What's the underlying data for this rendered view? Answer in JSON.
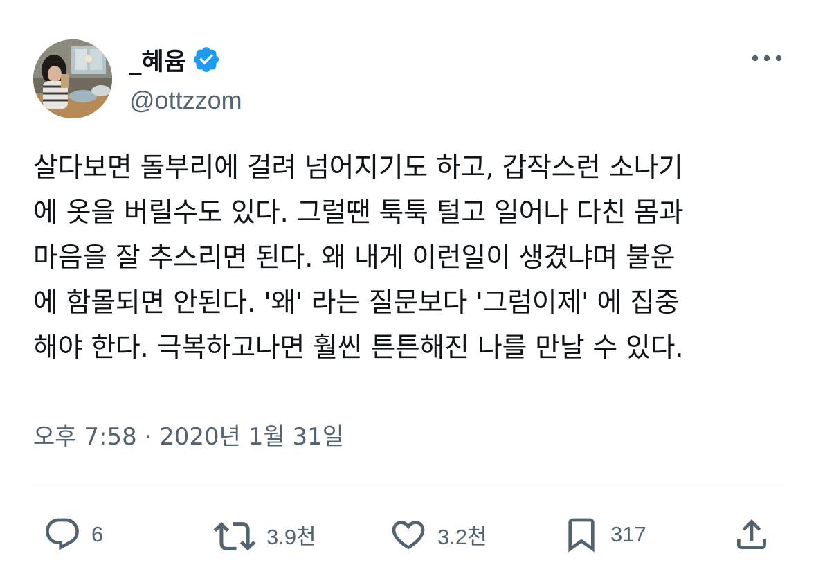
{
  "author": {
    "display_name": "_혜윰",
    "handle": "@ottzzom",
    "verified": true
  },
  "tweet": {
    "lines": [
      "살다보면 돌부리에 걸려 넘어지기도 하고, 갑작스런 소나기",
      "에 옷을 버릴수도 있다. 그럴땐 툭툭 털고 일어나 다친 몸과",
      "마음을 잘 추스리면 된다. 왜 내게 이런일이 생겼냐며 불운",
      "에 함몰되면 안된다. '왜' 라는 질문보다 '그럼이제' 에 집중",
      "해야 한다. 극복하고나면 훨씬 튼튼해진 나를 만날 수 있다."
    ],
    "timestamp": "오후 7:58 · 2020년 1월 31일"
  },
  "actions": {
    "replies": "6",
    "retweets": "3.9천",
    "likes": "3.2천",
    "bookmarks": "317"
  },
  "icons": {
    "verified": "verified-badge-icon",
    "more": "more-options-icon",
    "reply": "reply-icon",
    "retweet": "retweet-icon",
    "like": "heart-icon",
    "bookmark": "bookmark-icon",
    "share": "share-icon"
  },
  "colors": {
    "verified_blue": "#1d9bf0",
    "text_primary": "#0f1419",
    "text_secondary": "#536471",
    "divider": "#eff3f4"
  }
}
